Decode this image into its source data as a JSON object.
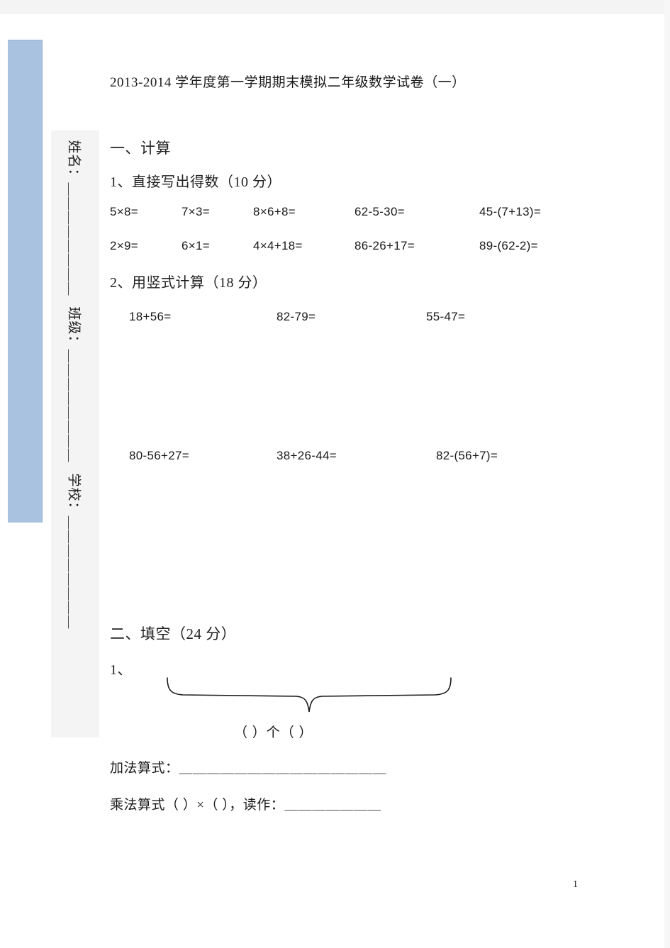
{
  "document": {
    "title": "2013-2014 学年度第一学期期末模拟二年级数学试卷（一）",
    "page_number": "1"
  },
  "student_info": {
    "name_field": "姓名：＿＿＿＿＿＿＿＿",
    "class_field": "班级：＿＿＿＿＿＿＿＿",
    "school_field": "学校：＿＿＿＿＿＿＿＿"
  },
  "sections": [
    {
      "heading": "一、计算",
      "subsections": [
        {
          "heading": "1、直接写出得数（10 分）",
          "rows": [
            [
              "5×8=",
              "7×3=",
              "8×6+8=",
              "62-5-30=",
              "45-(7+13)="
            ],
            [
              "2×9=",
              "6×1=",
              "4×4+18=",
              "86-26+17=",
              "89-(62-2)="
            ]
          ]
        },
        {
          "heading": "2、用竖式计算（18 分）",
          "rows": [
            [
              "18+56=",
              "82-79=",
              "55-47="
            ],
            [
              "80-56+27=",
              "38+26-44=",
              "82-(56+7)="
            ]
          ]
        }
      ]
    },
    {
      "heading": "二、填空（24 分）",
      "subsections": [
        {
          "heading": "1、",
          "brace_answer": "（          ）个（          ）",
          "addition_line": "加法算式：＿＿＿＿＿＿＿＿＿＿＿＿＿＿＿",
          "multiplication_line": "乘法算式（          ）×（          ），读作：＿＿＿＿＿＿＿"
        }
      ]
    }
  ],
  "colors": {
    "blue_band": "#a9c2e0",
    "info_column": "#f4f4f4",
    "text": "#1a1a1a"
  }
}
